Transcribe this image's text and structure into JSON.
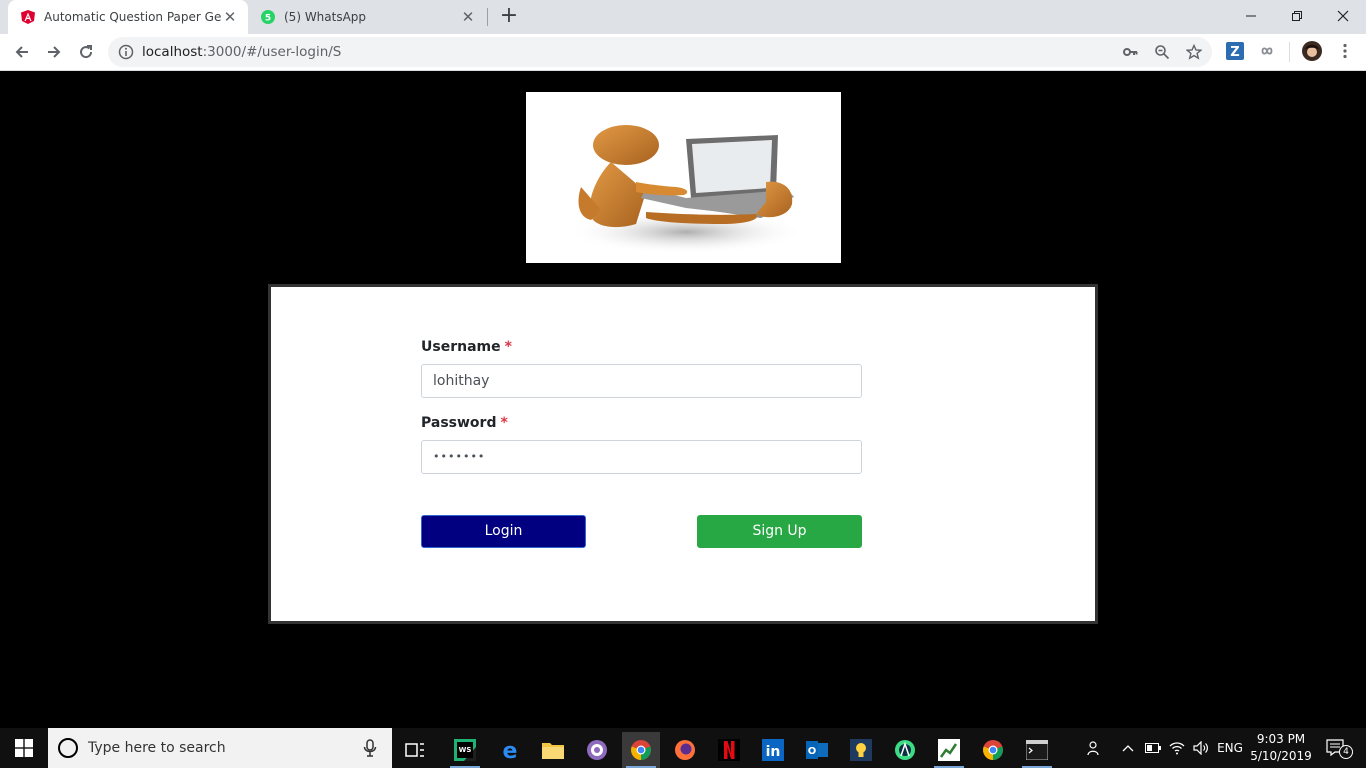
{
  "browser": {
    "tabs": [
      {
        "title": "Automatic Question Paper Gener",
        "icon": "angular-icon",
        "active": true
      },
      {
        "title": "(5) WhatsApp",
        "icon": "whatsapp-icon",
        "badge": "5",
        "active": false
      }
    ],
    "url": {
      "host": "localhost",
      "path": ":3000/#/user-login/S"
    }
  },
  "form": {
    "username": {
      "label": "Username",
      "required_mark": "*",
      "value": "lohithay"
    },
    "password": {
      "label": "Password",
      "required_mark": "*",
      "value": "•••••••"
    },
    "login_label": "Login",
    "signup_label": "Sign Up"
  },
  "taskbar": {
    "search_placeholder": "Type here to search",
    "language": "ENG",
    "time": "9:03 PM",
    "date": "5/10/2019",
    "notification_count": "4",
    "apps": [
      "task-view-icon",
      "webstorm-icon",
      "edge-icon",
      "file-explorer-icon",
      "app-icon",
      "chrome-icon",
      "firefox-icon",
      "netflix-icon",
      "linkedin-icon",
      "outlook-icon",
      "tips-icon",
      "android-studio-icon",
      "app-icon",
      "chrome-icon",
      "cmd-icon"
    ]
  },
  "colors": {
    "login_button": "#000080",
    "signup_button": "#28a745",
    "required": "#dc3545",
    "page_background": "#000000"
  }
}
